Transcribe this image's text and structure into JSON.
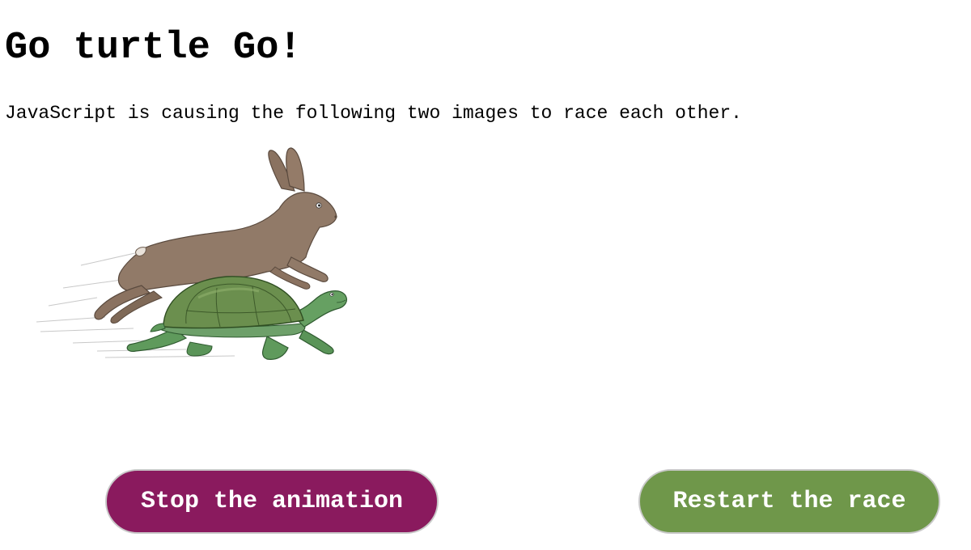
{
  "page": {
    "title": "Go turtle Go!",
    "intro": "JavaScript is causing the following two images to race each other."
  },
  "images": {
    "hare": "running-hare-icon",
    "tortoise": "walking-tortoise-icon"
  },
  "buttons": {
    "stop_label": "Stop the animation",
    "restart_label": "Restart the race"
  },
  "colors": {
    "stop_button": "#8a1a5e",
    "restart_button": "#6f974a",
    "hare_fur": "#8f7866",
    "tortoise_shell": "#6a8f4f",
    "tortoise_skin": "#5f9a5c"
  }
}
